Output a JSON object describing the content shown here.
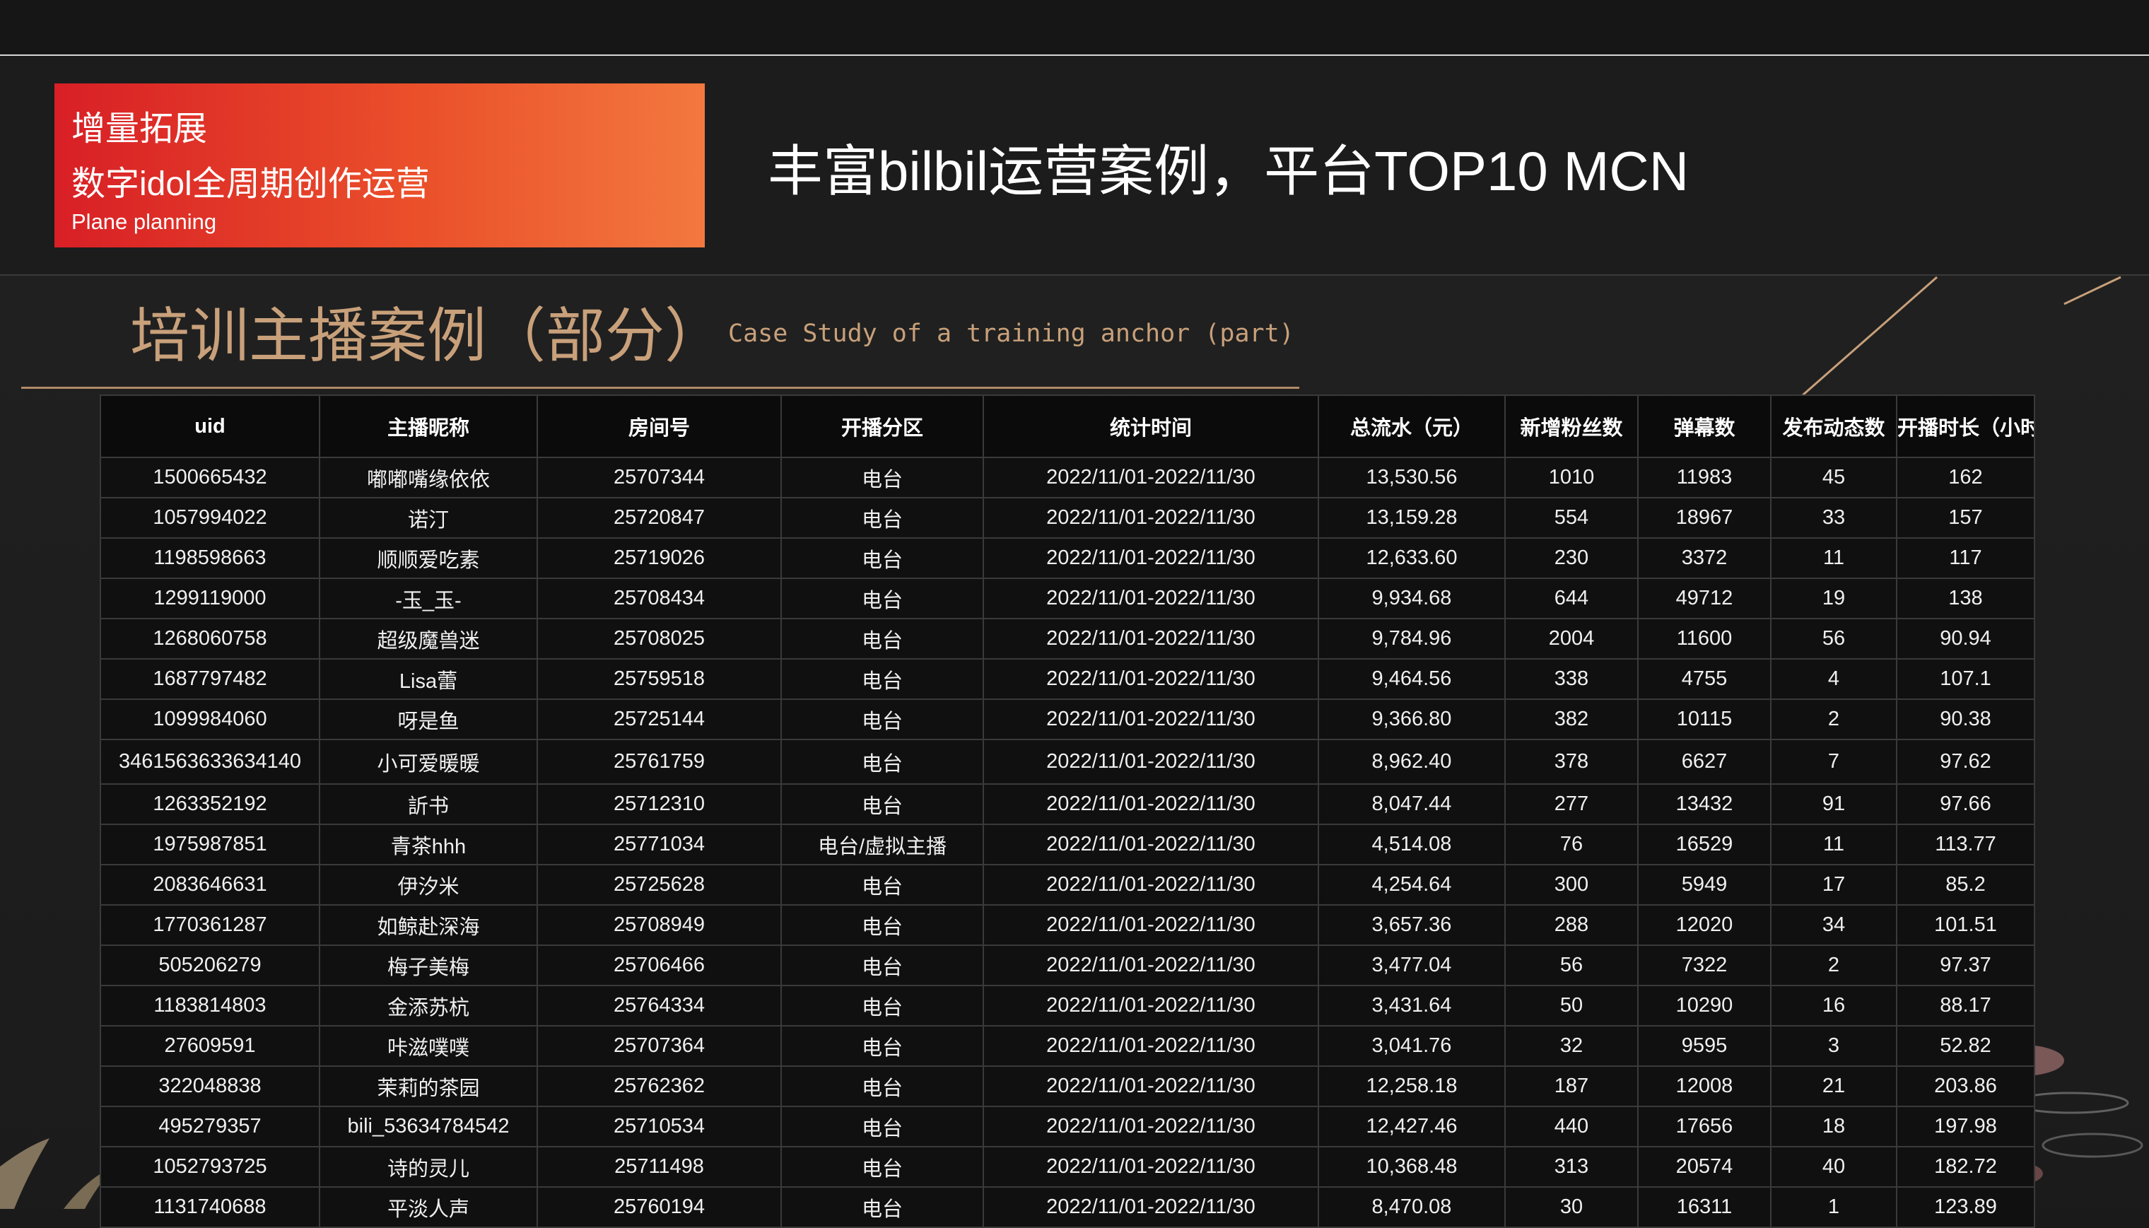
{
  "header": {
    "label_line1": "增量拓展",
    "label_line2": "数字idol全周期创作运营",
    "label_line3": "Plane planning",
    "headline": "丰富bilbil运营案例，平台TOP10 MCN"
  },
  "section": {
    "title": "培训主播案例（部分）",
    "subtitle": "Case Study of a training anchor (part)"
  },
  "table": {
    "headers": [
      "uid",
      "主播昵称",
      "房间号",
      "开播分区",
      "统计时间",
      "总流水（元）",
      "新增粉丝数",
      "弹幕数",
      "发布动态数",
      "开播时长（小时）"
    ],
    "rows": [
      [
        "1500665432",
        "嘟嘟嘴缘依依",
        "25707344",
        "电台",
        "2022/11/01-2022/11/30",
        "13,530.56",
        "1010",
        "11983",
        "45",
        "162"
      ],
      [
        "1057994022",
        "诺汀",
        "25720847",
        "电台",
        "2022/11/01-2022/11/30",
        "13,159.28",
        "554",
        "18967",
        "33",
        "157"
      ],
      [
        "1198598663",
        "顺顺爱吃素",
        "25719026",
        "电台",
        "2022/11/01-2022/11/30",
        "12,633.60",
        "230",
        "3372",
        "11",
        "117"
      ],
      [
        "1299119000",
        "-玉_玉-",
        "25708434",
        "电台",
        "2022/11/01-2022/11/30",
        "9,934.68",
        "644",
        "49712",
        "19",
        "138"
      ],
      [
        "1268060758",
        "超级魔兽迷",
        "25708025",
        "电台",
        "2022/11/01-2022/11/30",
        "9,784.96",
        "2004",
        "11600",
        "56",
        "90.94"
      ],
      [
        "1687797482",
        "Lisa蕾",
        "25759518",
        "电台",
        "2022/11/01-2022/11/30",
        "9,464.56",
        "338",
        "4755",
        "4",
        "107.1"
      ],
      [
        "1099984060",
        "呀是鱼",
        "25725144",
        "电台",
        "2022/11/01-2022/11/30",
        "9,366.80",
        "382",
        "10115",
        "2",
        "90.38"
      ],
      [
        "3461563633634140",
        "小可爱暖暖",
        "25761759",
        "电台",
        "2022/11/01-2022/11/30",
        "8,962.40",
        "378",
        "6627",
        "7",
        "97.62"
      ],
      [
        "1263352192",
        "訢书",
        "25712310",
        "电台",
        "2022/11/01-2022/11/30",
        "8,047.44",
        "277",
        "13432",
        "91",
        "97.66"
      ],
      [
        "1975987851",
        "青茶hhh",
        "25771034",
        "电台/虚拟主播",
        "2022/11/01-2022/11/30",
        "4,514.08",
        "76",
        "16529",
        "11",
        "113.77"
      ],
      [
        "2083646631",
        "伊汐米",
        "25725628",
        "电台",
        "2022/11/01-2022/11/30",
        "4,254.64",
        "300",
        "5949",
        "17",
        "85.2"
      ],
      [
        "1770361287",
        "如鲸赴深海",
        "25708949",
        "电台",
        "2022/11/01-2022/11/30",
        "3,657.36",
        "288",
        "12020",
        "34",
        "101.51"
      ],
      [
        "505206279",
        "梅子美梅",
        "25706466",
        "电台",
        "2022/11/01-2022/11/30",
        "3,477.04",
        "56",
        "7322",
        "2",
        "97.37"
      ],
      [
        "1183814803",
        "金添苏杭",
        "25764334",
        "电台",
        "2022/11/01-2022/11/30",
        "3,431.64",
        "50",
        "10290",
        "16",
        "88.17"
      ],
      [
        "27609591",
        "咔滋噗噗",
        "25707364",
        "电台",
        "2022/11/01-2022/11/30",
        "3,041.76",
        "32",
        "9595",
        "3",
        "52.82"
      ],
      [
        "322048838",
        "茉莉的茶园",
        "25762362",
        "电台",
        "2022/11/01-2022/11/30",
        "12,258.18",
        "187",
        "12008",
        "21",
        "203.86"
      ],
      [
        "495279357",
        "bili_53634784542",
        "25710534",
        "电台",
        "2022/11/01-2022/11/30",
        "12,427.46",
        "440",
        "17656",
        "18",
        "197.98"
      ],
      [
        "1052793725",
        "诗的灵儿",
        "25711498",
        "电台",
        "2022/11/01-2022/11/30",
        "10,368.48",
        "313",
        "20574",
        "40",
        "182.72"
      ],
      [
        "1131740688",
        "平淡人声",
        "25760194",
        "电台",
        "2022/11/01-2022/11/30",
        "8,470.08",
        "30",
        "16311",
        "1",
        "123.89"
      ]
    ]
  },
  "colors": {
    "accent_red": "#d81f26",
    "accent_orange": "#f3783f",
    "gold": "#c8a07a",
    "background": "#1a1a1a"
  }
}
